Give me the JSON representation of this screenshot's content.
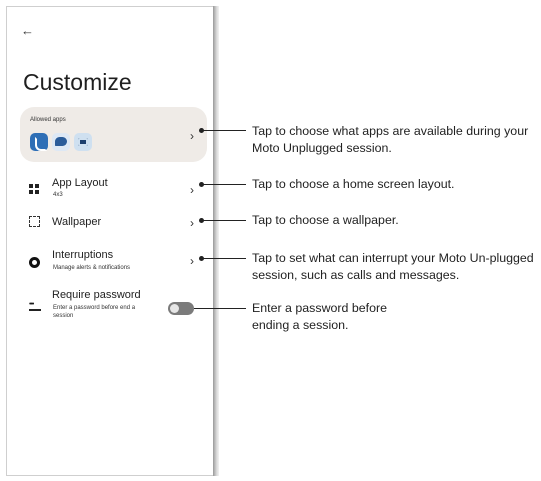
{
  "screen": {
    "back_icon_glyph": "←",
    "title": "Customize",
    "allowed_apps": {
      "label": "Allowed apps",
      "apps": [
        "phone-icon",
        "messages-icon",
        "camera-icon"
      ]
    },
    "rows": [
      {
        "label": "App Layout",
        "sublabel": "4x3",
        "icon": "app-layout-icon"
      },
      {
        "label": "Wallpaper",
        "sublabel": "",
        "icon": "wallpaper-icon"
      },
      {
        "label": "Interruptions",
        "sublabel": "Manage alerts & notifications",
        "icon": "interruptions-icon"
      },
      {
        "label": "Require password",
        "sublabel": "Enter a password before end a session",
        "icon": "password-icon"
      }
    ],
    "chevron_glyph": "›",
    "password_toggle_on": false
  },
  "callouts": [
    "Tap to choose what apps are available during your Moto Unplugged session.",
    "Tap to choose a home screen layout.",
    "Tap to choose a wallpaper.",
    "Tap to set what can interrupt your Moto Un-plugged session, such as calls and messages.",
    "Enter a password before ending a session."
  ],
  "colors": {
    "card_bg": "#efebe7",
    "toggle_off": "#7b7b7b",
    "app_blue": "#2f6fb6"
  }
}
